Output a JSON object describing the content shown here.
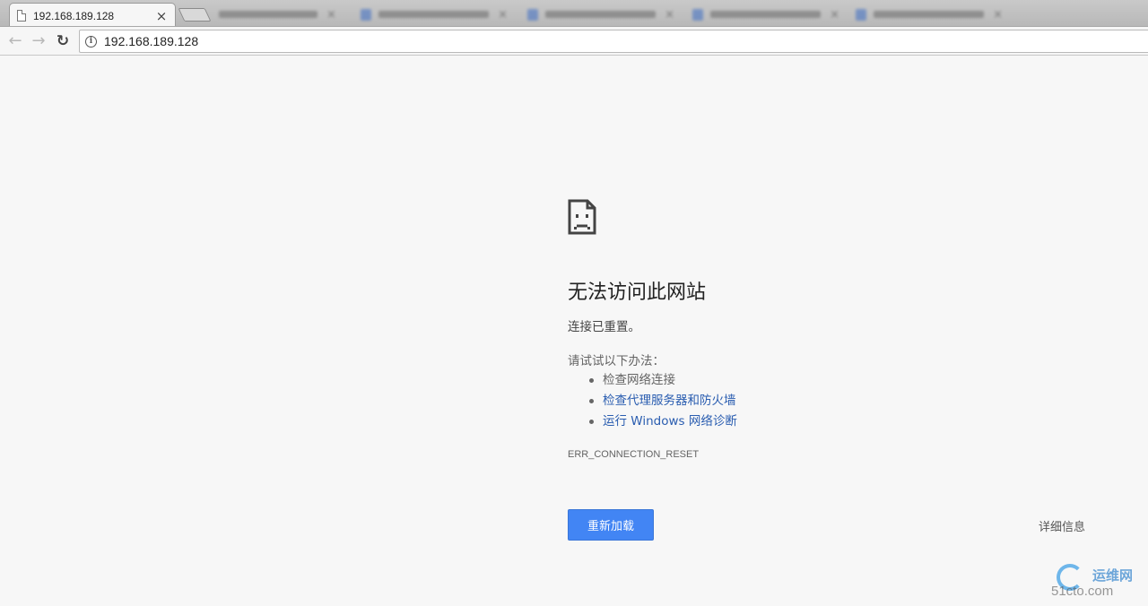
{
  "browser": {
    "active_tab": {
      "title": "192.168.189.128",
      "close_label": "×"
    },
    "address_bar": {
      "url": "192.168.189.128",
      "info_glyph": "i"
    },
    "nav": {
      "back": "←",
      "forward": "→",
      "reload": "↻"
    }
  },
  "error": {
    "title": "无法访问此网站",
    "subtitle": "连接已重置。",
    "try_label": "请试试以下办法：",
    "suggestions": [
      {
        "text": "检查网络连接",
        "link": false
      },
      {
        "text": "检查代理服务器和防火墙",
        "link": true
      },
      {
        "text": "运行 Windows 网络诊断",
        "link": true
      }
    ],
    "code": "ERR_CONNECTION_RESET",
    "reload_button": "重新加载",
    "details_link": "详细信息"
  },
  "watermark": {
    "cn": "运维网",
    "en": "51cto.com"
  },
  "colors": {
    "accent": "#4285f4",
    "link": "#2a5db0",
    "background": "#f7f7f7"
  },
  "icons": [
    "page-icon",
    "sad-page-icon",
    "info-icon",
    "back-arrow-icon",
    "forward-arrow-icon",
    "reload-icon",
    "close-icon"
  ]
}
